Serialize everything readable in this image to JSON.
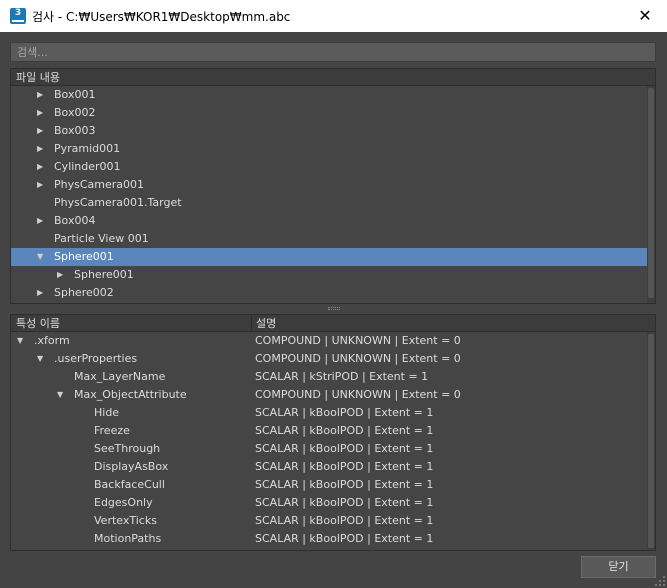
{
  "window": {
    "title": "검사 - C:₩Users₩KOR1₩Desktop₩mm.abc",
    "app_icon_glyph": "3",
    "close_glyph": "✕"
  },
  "search": {
    "placeholder": "검색..."
  },
  "file_panel": {
    "header": "파일 내용",
    "items": [
      {
        "label": "Box001",
        "level": 0,
        "arrow": "right",
        "selected": false
      },
      {
        "label": "Box002",
        "level": 0,
        "arrow": "right",
        "selected": false
      },
      {
        "label": "Box003",
        "level": 0,
        "arrow": "right",
        "selected": false
      },
      {
        "label": "Pyramid001",
        "level": 0,
        "arrow": "right",
        "selected": false
      },
      {
        "label": "Cylinder001",
        "level": 0,
        "arrow": "right",
        "selected": false
      },
      {
        "label": "PhysCamera001",
        "level": 0,
        "arrow": "right",
        "selected": false
      },
      {
        "label": "PhysCamera001.Target",
        "level": 0,
        "arrow": "none",
        "selected": false
      },
      {
        "label": "Box004",
        "level": 0,
        "arrow": "right",
        "selected": false
      },
      {
        "label": "Particle View 001",
        "level": 0,
        "arrow": "none",
        "selected": false
      },
      {
        "label": "Sphere001",
        "level": 0,
        "arrow": "down",
        "selected": true
      },
      {
        "label": "Sphere001",
        "level": 1,
        "arrow": "right",
        "selected": false
      },
      {
        "label": "Sphere002",
        "level": 0,
        "arrow": "right",
        "selected": false
      }
    ]
  },
  "props_panel": {
    "col_name": "특성 이름",
    "col_desc": "설명",
    "rows": [
      {
        "name": ".xform",
        "level": 0,
        "arrow": "down",
        "desc": "COMPOUND | UNKNOWN | Extent = 0"
      },
      {
        "name": ".userProperties",
        "level": 1,
        "arrow": "down",
        "desc": "COMPOUND | UNKNOWN | Extent = 0"
      },
      {
        "name": "Max_LayerName",
        "level": 2,
        "arrow": "none",
        "desc": "SCALAR | kStriPOD | Extent = 1"
      },
      {
        "name": "Max_ObjectAttribute",
        "level": 2,
        "arrow": "down",
        "desc": "COMPOUND | UNKNOWN | Extent = 0"
      },
      {
        "name": "Hide",
        "level": 3,
        "arrow": "none",
        "desc": "SCALAR | kBoolPOD | Extent = 1"
      },
      {
        "name": "Freeze",
        "level": 3,
        "arrow": "none",
        "desc": "SCALAR | kBoolPOD | Extent = 1"
      },
      {
        "name": "SeeThrough",
        "level": 3,
        "arrow": "none",
        "desc": "SCALAR | kBoolPOD | Extent = 1"
      },
      {
        "name": "DisplayAsBox",
        "level": 3,
        "arrow": "none",
        "desc": "SCALAR | kBoolPOD | Extent = 1"
      },
      {
        "name": "BackfaceCull",
        "level": 3,
        "arrow": "none",
        "desc": "SCALAR | kBoolPOD | Extent = 1"
      },
      {
        "name": "EdgesOnly",
        "level": 3,
        "arrow": "none",
        "desc": "SCALAR | kBoolPOD | Extent = 1"
      },
      {
        "name": "VertexTicks",
        "level": 3,
        "arrow": "none",
        "desc": "SCALAR | kBoolPOD | Extent = 1"
      },
      {
        "name": "MotionPaths",
        "level": 3,
        "arrow": "none",
        "desc": "SCALAR | kBoolPOD | Extent = 1"
      }
    ]
  },
  "footer": {
    "close_label": "닫기"
  },
  "colors": {
    "background": "#444444",
    "panel": "#454545",
    "selection": "#5b86bd",
    "titlebar": "#ffffff",
    "app_icon": "#1e78b4"
  }
}
